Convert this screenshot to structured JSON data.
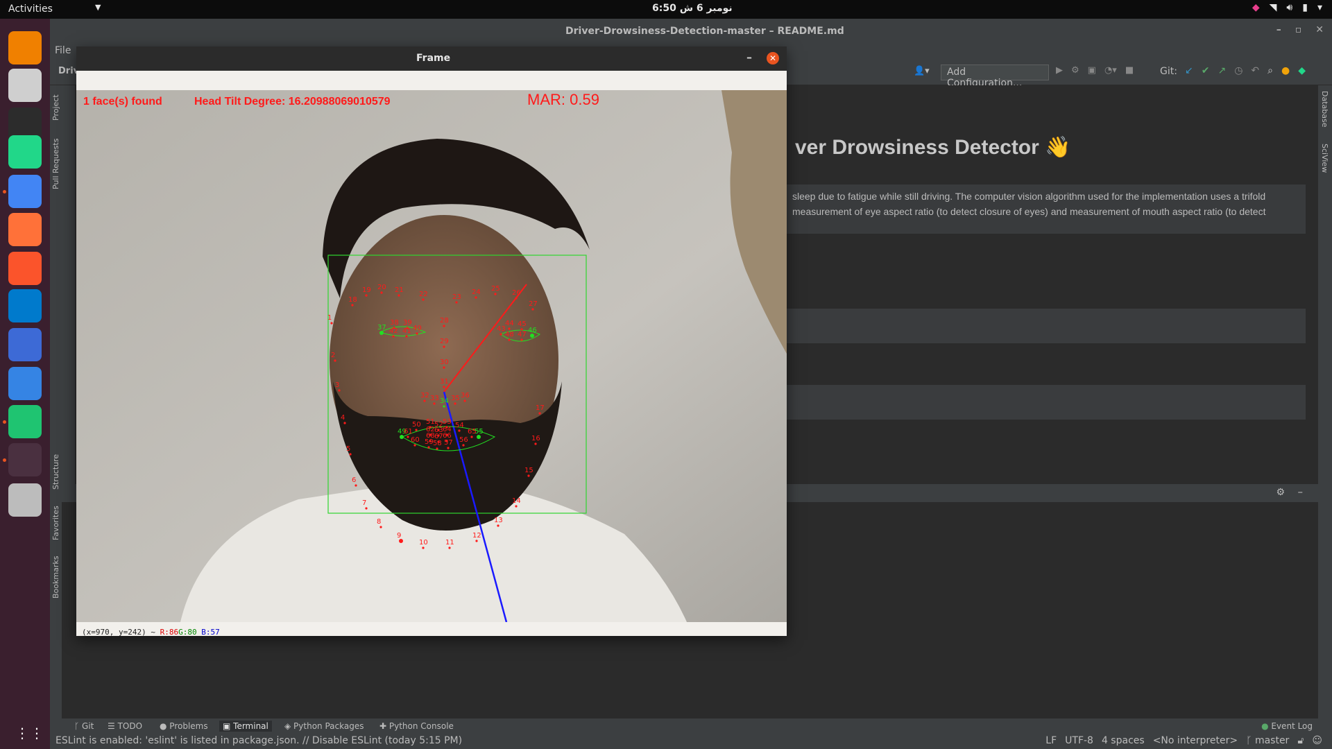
{
  "topbar": {
    "activities": "Activities",
    "clock": "6:50  نومبر 6  ش"
  },
  "dock": {
    "apps": [
      {
        "name": "vlc-icon",
        "label": "VLC",
        "color": "#f08000"
      },
      {
        "name": "files-icon",
        "label": "Files",
        "color": "#cfcfcf"
      },
      {
        "name": "terminal-icon",
        "label": ">_",
        "color": "#2c2c2c"
      },
      {
        "name": "pycharm-eap-icon",
        "label": "PC EAP",
        "color": "#21d789"
      },
      {
        "name": "chrome-icon",
        "label": "Chrome",
        "color": "#4285f4"
      },
      {
        "name": "firefox-icon",
        "label": "Firefox",
        "color": "#ff7139"
      },
      {
        "name": "brave-icon",
        "label": "Brave",
        "color": "#fb542b"
      },
      {
        "name": "vscode-icon",
        "label": "VS Code",
        "color": "#007acc"
      },
      {
        "name": "tasks-icon",
        "label": "Tasks",
        "color": "#3d6ad6"
      },
      {
        "name": "text-editor-icon",
        "label": "Editor",
        "color": "#3584e4"
      },
      {
        "name": "pycharm-icon",
        "label": "PC",
        "color": "#1fc471"
      },
      {
        "name": "active-window-icon",
        "label": "",
        "color": "#4a3040"
      },
      {
        "name": "ssd-icon",
        "label": "SSD",
        "color": "#bcbcbc"
      }
    ],
    "grid_icon": "show-apps-grid-icon"
  },
  "ide": {
    "title": "Driver-Drowsiness-Detection-master – README.md",
    "menu_file": "File",
    "breadcrumb": "Driv",
    "add_configuration": "Add Configuration...",
    "git_label": "Git:",
    "left_tabs": {
      "project": "Project",
      "pull_requests": "Pull Requests",
      "structure": "Structure",
      "favorites": "Favorites",
      "bookmarks": "Bookmarks"
    },
    "right_tabs": {
      "database": "Database",
      "sciview": "SciView"
    },
    "readme": {
      "title": "ver Drowsiness Detector 👋",
      "line1": "sleep due to fatigue while still driving. The computer vision algorithm used for the implementation uses a trifold",
      "line2": "measurement of eye aspect ratio (to detect closure of eyes) and measurement of mouth aspect ratio (to detect"
    },
    "bottom_tabs": [
      {
        "label": "Git",
        "icon": "git-icon"
      },
      {
        "label": "TODO",
        "icon": "todo-icon"
      },
      {
        "label": "Problems",
        "icon": "problems-icon"
      },
      {
        "label": "Terminal",
        "icon": "terminal-tab-icon"
      },
      {
        "label": "Python Packages",
        "icon": "packages-icon"
      },
      {
        "label": "Python Console",
        "icon": "python-console-icon"
      }
    ],
    "event_log": "Event Log",
    "status": {
      "message": "ESLint is enabled: 'eslint' is listed in package.json. // Disable ESLint (today 5:15 PM)",
      "lf": "LF",
      "encoding": "UTF-8",
      "indent": "4 spaces",
      "interpreter": "<No interpreter>",
      "branch": "master"
    }
  },
  "frame": {
    "title": "Frame",
    "overlay": {
      "faces": "1 face(s) found",
      "tilt": "Head Tilt Degree: 16.20988069010579",
      "mar": "MAR: 0.59"
    },
    "status": {
      "coords": "(x=970, y=242) ~",
      "r": "R:86",
      "g": "G:80",
      "b": "B:57"
    },
    "colors": {
      "overlay_red": "#ff1a1a",
      "landmark_green": "#22e022",
      "box_green": "#2fd62f",
      "axis_blue": "#1a1aff"
    }
  }
}
